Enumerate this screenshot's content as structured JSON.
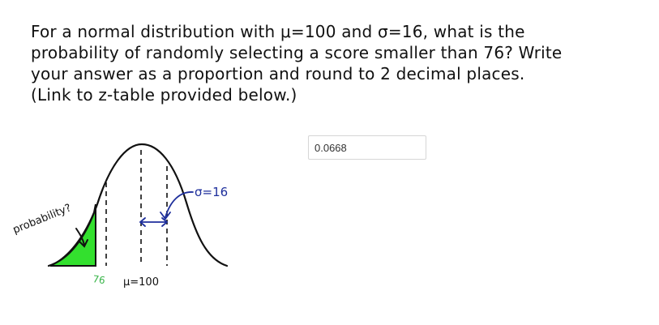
{
  "question": {
    "lines": [
      "For a normal distribution with μ=100 and σ=16, what is the",
      "probability of randomly selecting a score smaller than 76? Write",
      "your answer as a proportion and round to  2 decimal places.",
      "(Link to z-table provided below.)"
    ]
  },
  "answer": {
    "value": "0.0668"
  },
  "figure": {
    "probability_label": "probability?",
    "sigma_label": "σ=16",
    "mean_label": "μ=100",
    "score_label": "76",
    "colors": {
      "shaded_area": "#33e02e",
      "score_label": "#3ab54a",
      "sigma_annotation": "#1e2f9c",
      "ink": "#111111"
    }
  }
}
